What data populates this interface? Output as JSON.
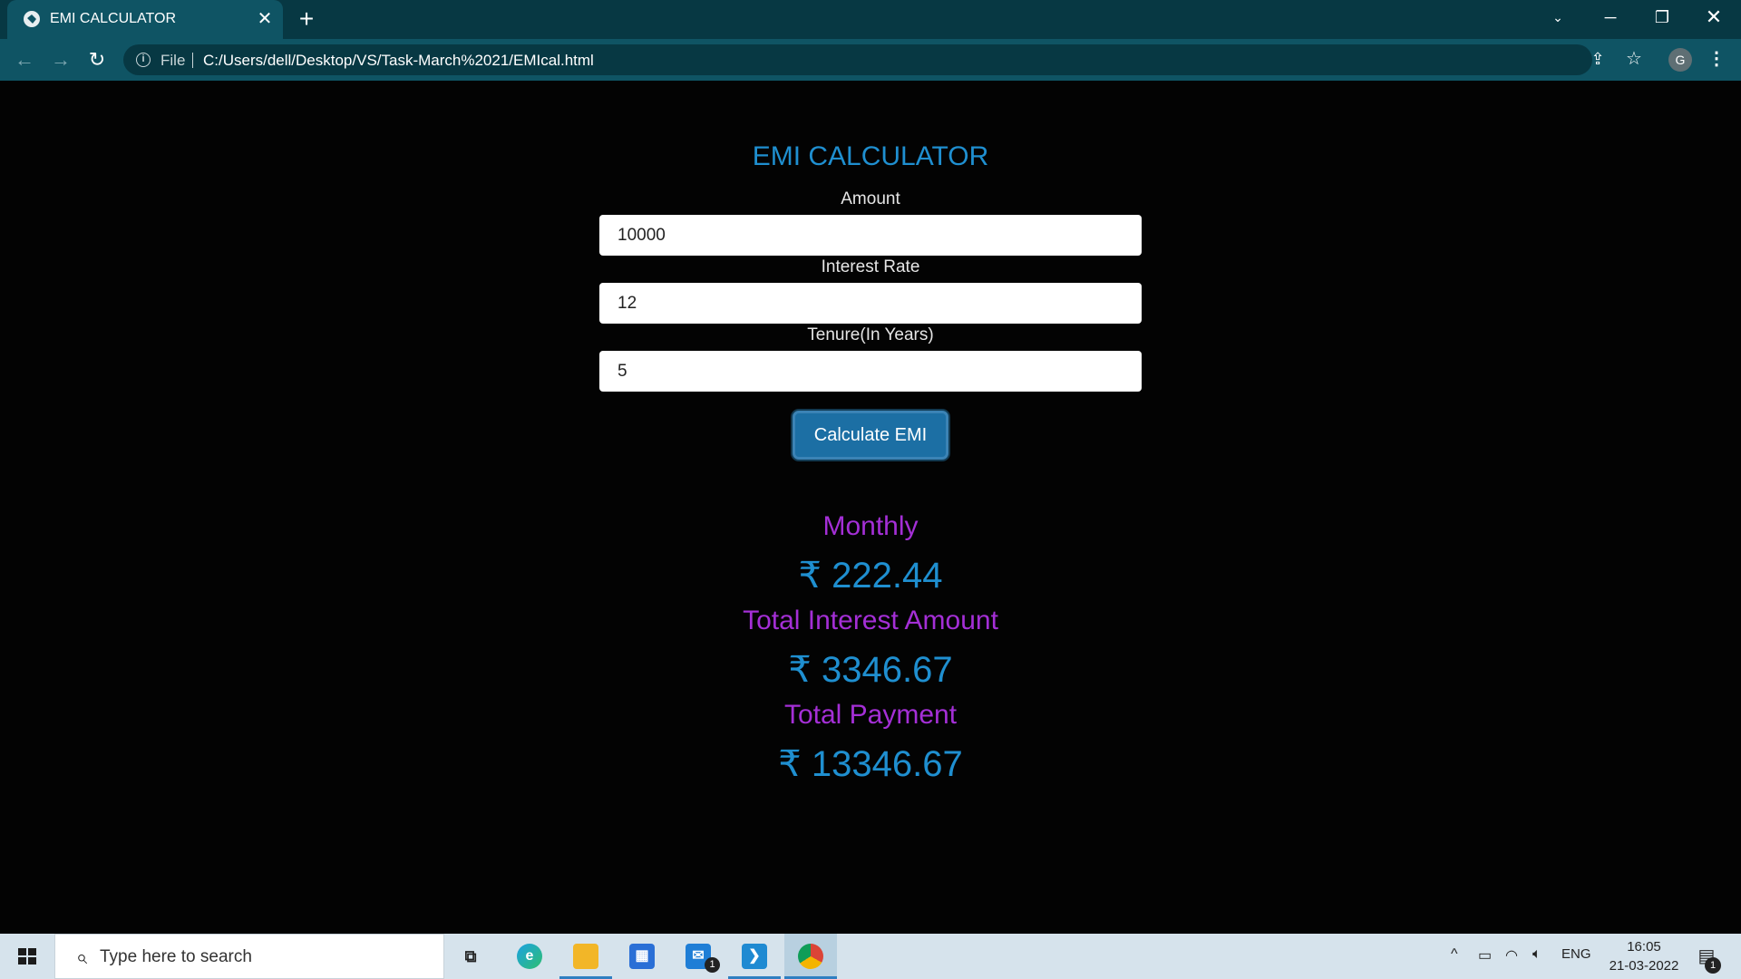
{
  "browser": {
    "tab_title": "EMI CALCULATOR",
    "tab_close": "✕",
    "new_tab": "+",
    "scheme_label": "File",
    "url": "C:/Users/dell/Desktop/VS/Task-March%2021/EMIcal.html",
    "profile_initial": "G"
  },
  "app": {
    "title": "EMI CALCULATOR",
    "fields": [
      {
        "label": "Amount",
        "value": "10000"
      },
      {
        "label": "Interest Rate",
        "value": "12"
      },
      {
        "label": "Tenure(In Years)",
        "value": "5"
      }
    ],
    "button_label": "Calculate EMI",
    "results": [
      {
        "label": "Monthly",
        "value": "₹ 222.44"
      },
      {
        "label": "Total Interest Amount",
        "value": "₹ 3346.67"
      },
      {
        "label": "Total Payment",
        "value": "₹ 13346.67"
      }
    ],
    "colors": {
      "title": "#1f8fd0",
      "result_label": "#a42fd6",
      "result_value": "#1f8fd0",
      "button": "#1c6fa4",
      "background": "#030303"
    }
  },
  "taskbar": {
    "search_placeholder": "Type here to search",
    "mail_badge": "1",
    "tray_language": "ENG",
    "time": "16:05",
    "date": "21-03-2022",
    "notification_badge": "1"
  }
}
